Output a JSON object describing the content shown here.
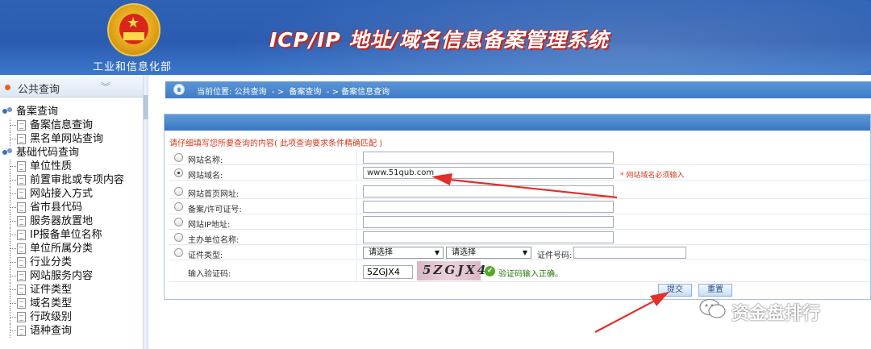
{
  "header": {
    "ministry": "工业和信息化部",
    "system_title": "ICP/IP 地址/域名信息备案管理系统"
  },
  "sidebar": {
    "section_title": "公共查询",
    "tree": [
      {
        "type": "group",
        "label": "备案查询"
      },
      {
        "type": "leaf",
        "label": "备案信息查询",
        "selected": true
      },
      {
        "type": "leaf",
        "label": "黑名单网站查询"
      },
      {
        "type": "group",
        "label": "基础代码查询"
      },
      {
        "type": "leaf",
        "label": "单位性质"
      },
      {
        "type": "leaf",
        "label": "前置审批或专项内容"
      },
      {
        "type": "leaf",
        "label": "网站接入方式"
      },
      {
        "type": "leaf",
        "label": "省市县代码"
      },
      {
        "type": "leaf",
        "label": "服务器放置地"
      },
      {
        "type": "leaf",
        "label": "IP报备单位名称"
      },
      {
        "type": "leaf",
        "label": "单位所属分类"
      },
      {
        "type": "leaf",
        "label": "行业分类"
      },
      {
        "type": "leaf",
        "label": "网站服务内容"
      },
      {
        "type": "leaf",
        "label": "证件类型"
      },
      {
        "type": "leaf",
        "label": "域名类型"
      },
      {
        "type": "leaf",
        "label": "行政级别"
      },
      {
        "type": "leaf",
        "label": "语种查询"
      }
    ]
  },
  "breadcrumb": "当前位置: 公共查询  - >  备案查询  - > 备案信息查询",
  "form": {
    "notice": "请仔细填写您所要查询的内容( 此项查询要求条件精确匹配 )",
    "fields": [
      {
        "label": "网站名称:",
        "value": "",
        "checked": false
      },
      {
        "label": "网站域名:",
        "value": "www.51qub.com",
        "checked": true,
        "hint": "* 网站域名必须输入"
      },
      {
        "label": "网站首页网址:",
        "value": "",
        "checked": false
      },
      {
        "label": "备案/许可证号:",
        "value": "",
        "checked": false
      },
      {
        "label": "网站IP地址:",
        "value": "",
        "checked": false
      },
      {
        "label": "主办单位名称:",
        "value": "",
        "checked": false
      }
    ],
    "cert": {
      "label": "证件类型:",
      "select1": "请选择",
      "select2": "请选择",
      "number_label": "证件号码:"
    },
    "captcha": {
      "label": "输入验证码:",
      "value": "5ZGJX4",
      "image_text": "5ZGJX4",
      "ok_text": "验证码输入正确。"
    },
    "submit_label": "提交",
    "reset_label": "重置"
  },
  "watermark": "资金盘排行",
  "colors": {
    "header_blue": "#2f62b5",
    "arrow_red": "#e0302a",
    "notice_red": "#d6381f"
  }
}
